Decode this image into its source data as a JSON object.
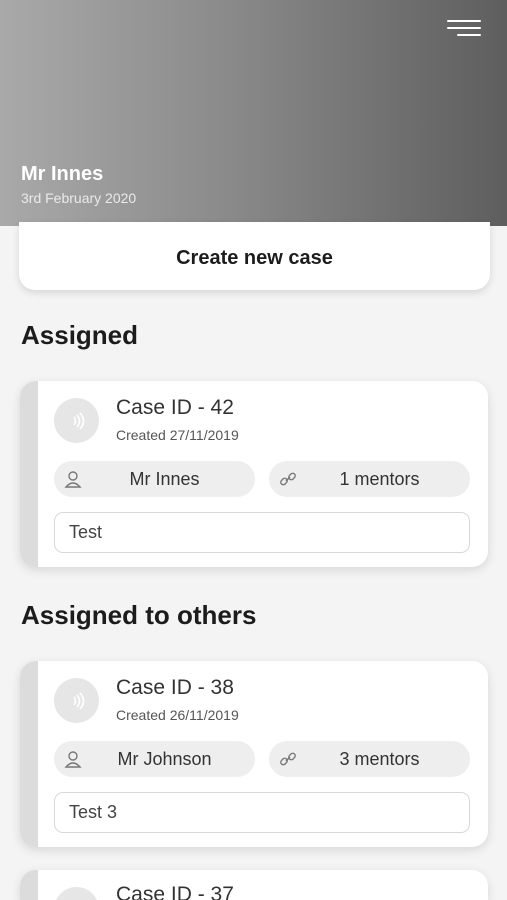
{
  "header": {
    "user_name": "Mr Innes",
    "date": "3rd February 2020"
  },
  "actions": {
    "create_case_label": "Create new case"
  },
  "sections": {
    "assigned_title": "Assigned",
    "others_title": "Assigned to others"
  },
  "cases": [
    {
      "id_label": "Case ID - 42",
      "created": "Created 27/11/2019",
      "user": "Mr Innes",
      "mentors": "1 mentors",
      "note": "Test"
    },
    {
      "id_label": "Case ID - 38",
      "created": "Created 26/11/2019",
      "user": "Mr Johnson",
      "mentors": "3 mentors",
      "note": "Test 3"
    },
    {
      "id_label": "Case ID - 37"
    }
  ],
  "icons": {
    "menu": "hamburger-menu-icon",
    "avatar": "sound-wave-icon",
    "user": "user-icon",
    "mentors": "link-icon"
  },
  "colors": {
    "header_gradient_start": "#a9a9a9",
    "header_gradient_end": "#5e5e5e",
    "card_stripe": "#dcdcdc",
    "background": "#f4f4f4"
  }
}
